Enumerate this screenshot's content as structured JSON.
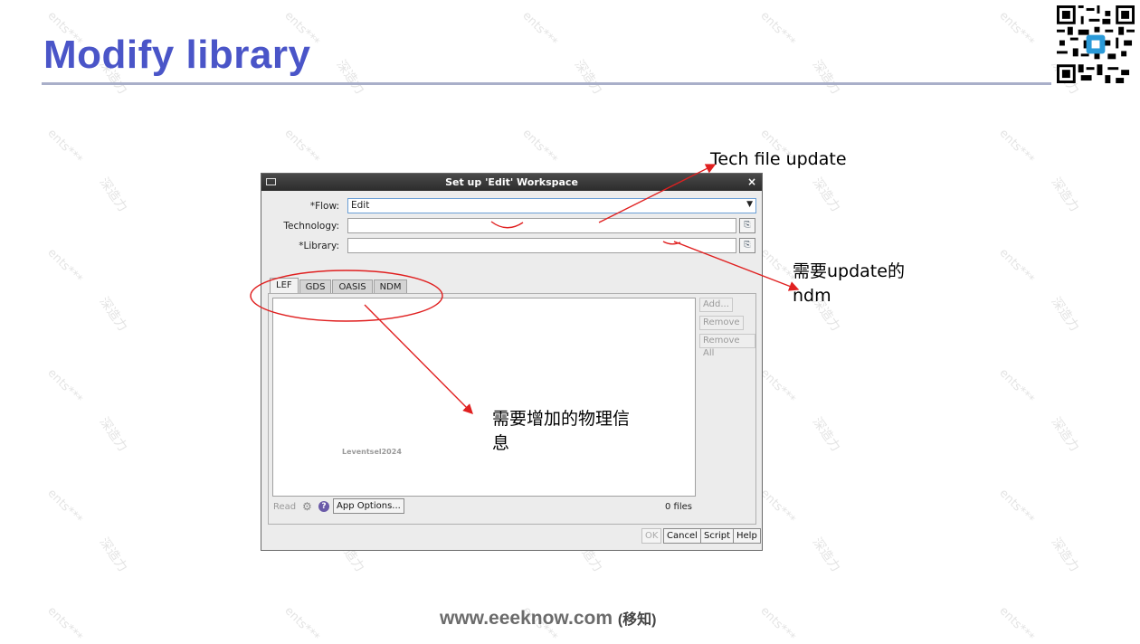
{
  "slide": {
    "title": "Modify library",
    "footer_site": "www.eeeknow.com",
    "footer_suffix": "(移知)",
    "watermark_en": "ents***",
    "watermark_cn": "深造力"
  },
  "dialog": {
    "title": "Set up 'Edit' Workspace",
    "close_glyph": "×",
    "flow_label": "*Flow:",
    "flow_value": "Edit",
    "dropdown_glyph": "▼",
    "technology_label": "Technology:",
    "technology_value": "",
    "library_label": "*Library:",
    "library_value": "",
    "tabs": [
      "LEF",
      "GDS",
      "OASIS",
      "NDM"
    ],
    "side_buttons": [
      "Add...",
      "Remove",
      "Remove All"
    ],
    "read_label": "Read",
    "app_options_label": "App Options...",
    "files_count": "0 files",
    "panel_watermark": "Leventsel2024",
    "buttons": {
      "ok": "OK",
      "cancel": "Cancel",
      "script": "Script",
      "help": "Help"
    },
    "icons": {
      "browse": "folder-browse-icon",
      "gear": "gear-icon",
      "help": "help-icon"
    }
  },
  "annotations": {
    "tech_file": "Tech file update",
    "ndm_line1": "需要update的",
    "ndm_line2": "ndm",
    "physical_line1": "需要增加的物理信",
    "physical_line2": "息",
    "arrow_color": "#e02020"
  }
}
